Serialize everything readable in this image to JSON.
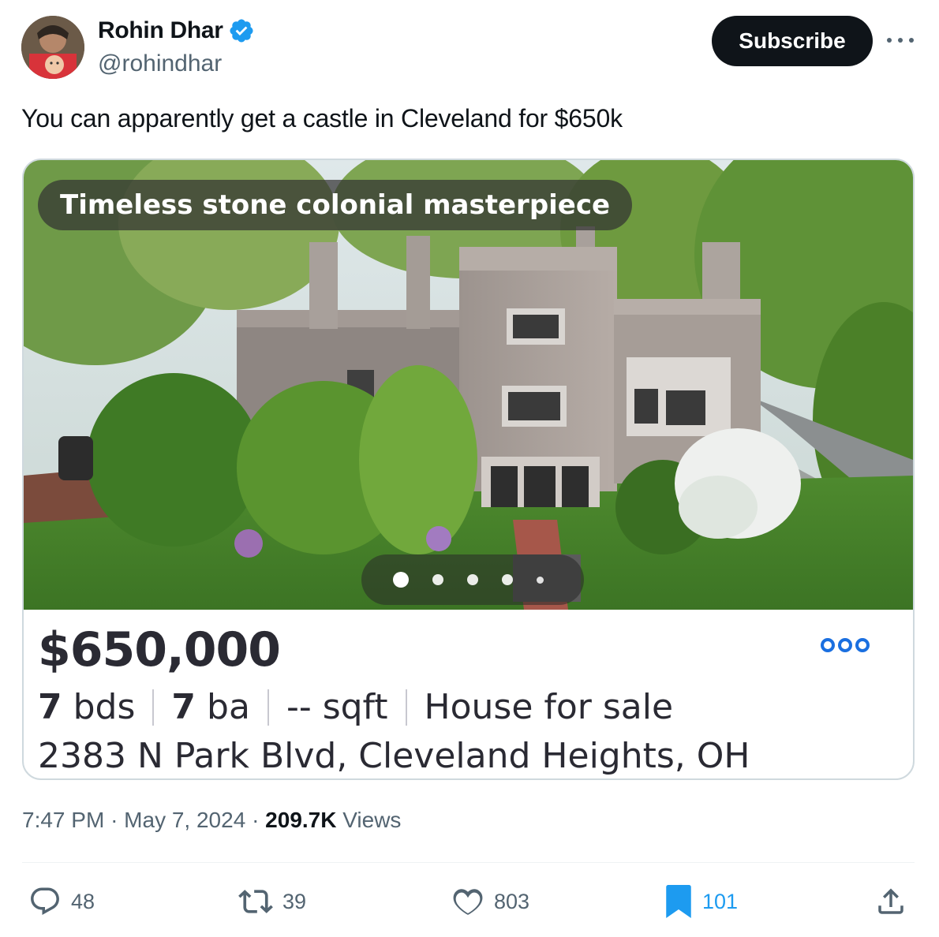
{
  "author": {
    "name": "Rohin Dhar",
    "handle": "@rohindhar",
    "verified": true
  },
  "subscribe_label": "Subscribe",
  "tweet_text": "You can apparently get a castle in Cleveland for $650k",
  "listing": {
    "caption": "Timeless stone colonial masterpiece",
    "price": "$650,000",
    "beds_value": "7",
    "beds_unit": "bds",
    "baths_value": "7",
    "baths_unit": "ba",
    "sqft": "-- sqft",
    "type": "House for sale",
    "address": "2383 N Park Blvd, Cleveland Heights, OH",
    "photo_index": 1,
    "accent_color": "#1a6fe0"
  },
  "meta": {
    "time": "7:47 PM",
    "date": "May 7, 2024",
    "views_count": "209.7K",
    "views_label": "Views"
  },
  "actions": {
    "replies": "48",
    "reposts": "39",
    "likes": "803",
    "bookmarks": "101"
  },
  "colors": {
    "text_primary": "#0f1419",
    "text_secondary": "#536471",
    "verified_blue": "#1d9bf0",
    "subscribe_bg": "#0f1419"
  },
  "icons": [
    "verified-badge-icon",
    "more-icon",
    "heart-icon",
    "reply-icon",
    "repost-icon",
    "like-icon",
    "bookmark-icon",
    "share-icon"
  ]
}
